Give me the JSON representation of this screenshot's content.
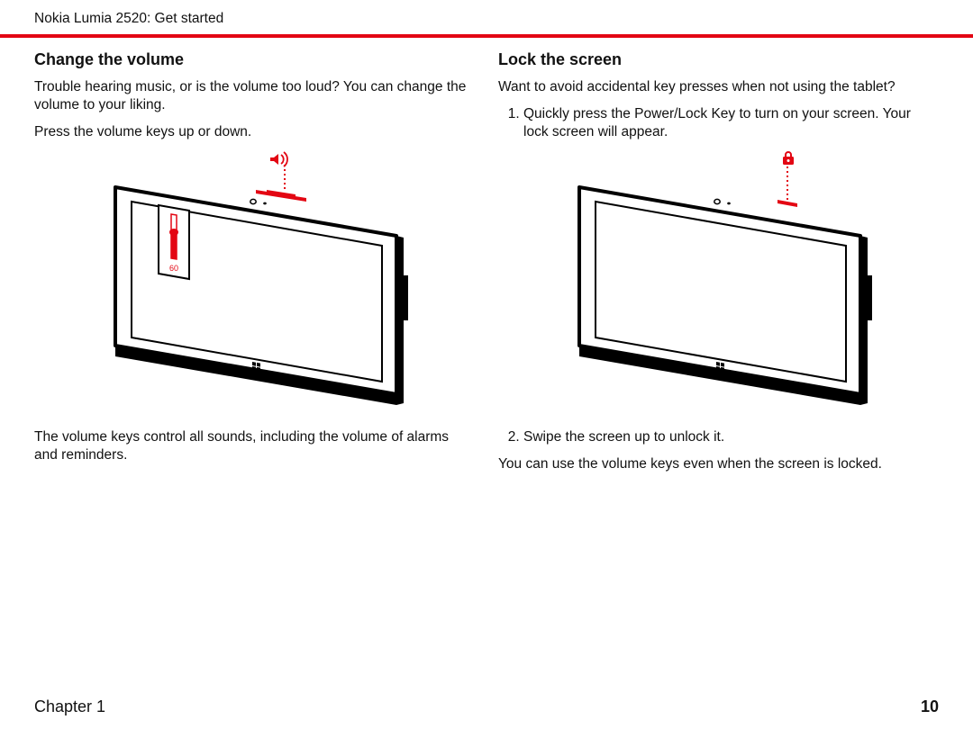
{
  "header": {
    "breadcrumb": "Nokia Lumia 2520: Get started"
  },
  "left": {
    "heading": "Change the volume",
    "para1": "Trouble hearing music, or is the volume too loud? You can change the volume to your liking.",
    "para2": "Press the volume keys up or down.",
    "fig": {
      "volume_value": "60",
      "icon": "volume-icon"
    },
    "para3": "The volume keys control all sounds, including the volume of alarms and reminders."
  },
  "right": {
    "heading": "Lock the screen",
    "para1": "Want to avoid accidental key presses when not using the tablet?",
    "list": [
      "Quickly press the Power/Lock Key to turn on your screen. Your lock screen will appear.",
      "Swipe the screen up to unlock it."
    ],
    "fig": {
      "icon": "lock-icon"
    },
    "para2": "You can use the volume keys even when the screen is locked."
  },
  "footer": {
    "chapter": "Chapter 1",
    "page": "10"
  },
  "colors": {
    "accent": "#e30613"
  }
}
